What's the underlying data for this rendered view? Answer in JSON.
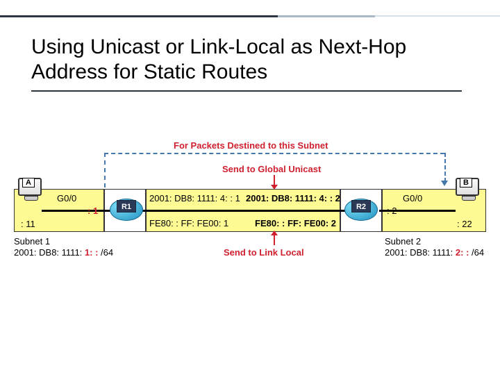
{
  "title": "Using Unicast or Link-Local as Next-Hop Address for Static Routes",
  "captions": {
    "destined": "For Packets Destined to this Subnet",
    "send_global": "Send to Global Unicast",
    "send_linklocal": "Send to Link Local"
  },
  "hosts": {
    "A": {
      "label": "A",
      "addr": ": 11"
    },
    "B": {
      "label": "B",
      "addr": ": 22"
    }
  },
  "routers": {
    "R1": {
      "name": "R1",
      "left_if": "G0/0",
      "left_local": ": 1",
      "left_local_hl": ": 1",
      "right_global": "2001: DB8: 1111: 4: : 1",
      "right_linklocal": "FE80: : FF: FE00: 1"
    },
    "R2": {
      "name": "R2",
      "left_global": "2001: DB8: 1111: 4: : 2",
      "left_linklocal": "FE80: : FF: FE00: 2",
      "right_if": "G0/0",
      "right_local": ": 2"
    }
  },
  "subnets": {
    "s1": {
      "name": "Subnet 1",
      "prefix_pre": "2001: DB8: 1111:",
      "prefix_hl": " 1: :",
      "mask": " /64"
    },
    "s2": {
      "name": "Subnet 2",
      "prefix_pre": "2001: DB8: 1111:",
      "prefix_hl": " 2: :",
      "mask": " /64"
    }
  }
}
